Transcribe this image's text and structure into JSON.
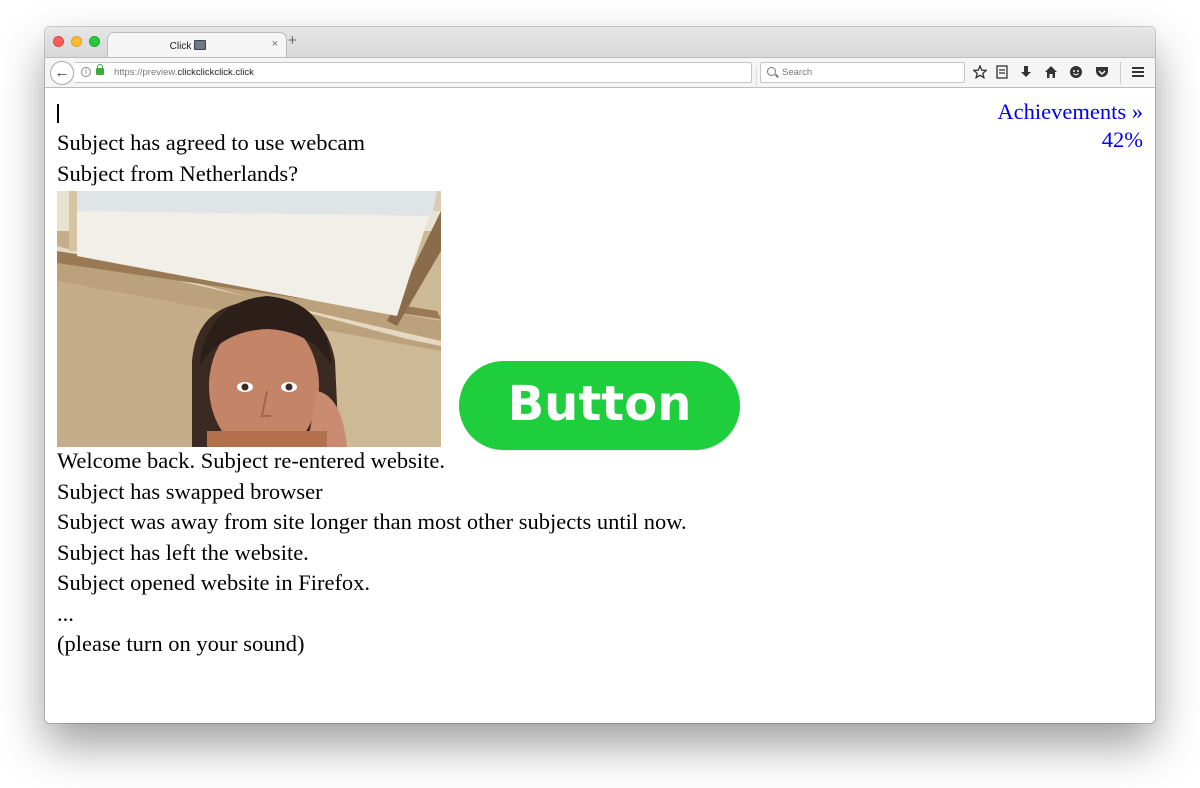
{
  "browser": {
    "tab": {
      "title": "Click",
      "close_glyph": "×",
      "new_tab_glyph": "+"
    },
    "nav": {
      "back_glyph": "←",
      "reload_glyph": "⟳"
    },
    "url": {
      "protocol": "https://preview.",
      "domain": "clickclickclick.click"
    },
    "search": {
      "placeholder": "Search"
    },
    "toolbar_icons": [
      "star-icon",
      "reading-list-icon",
      "download-icon",
      "home-icon",
      "smiley-icon",
      "pocket-icon",
      "menu-icon"
    ]
  },
  "page": {
    "achievements": {
      "label": "Achievements »",
      "percent": "42%"
    },
    "upper_lines": [
      "Subject has agreed to use webcam",
      "Subject from Netherlands?"
    ],
    "button_label": "Button",
    "lower_lines": [
      "Welcome back. Subject re-entered website.",
      "Subject has swapped browser",
      "Subject was away from site longer than most other subjects until now.",
      "Subject has left the website.",
      "Subject opened website in Firefox.",
      "...",
      "(please turn on your sound)"
    ],
    "colors": {
      "button_green": "#1ece3d",
      "link_blue": "#0000ee"
    }
  }
}
